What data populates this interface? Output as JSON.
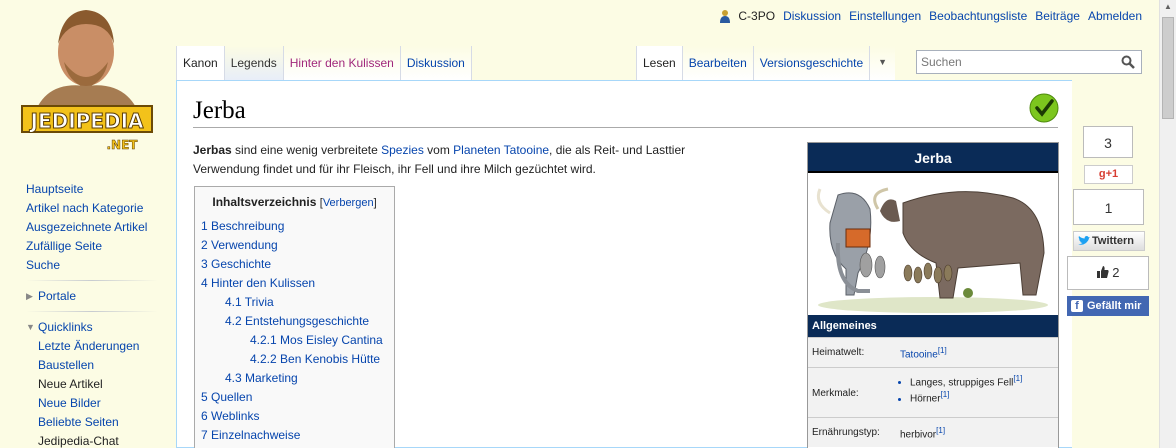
{
  "personal": {
    "username": "C-3PO",
    "links": [
      "Diskussion",
      "Einstellungen",
      "Beobachtungsliste",
      "Beiträge",
      "Abmelden"
    ]
  },
  "tabs": {
    "left": [
      "Kanon",
      "Legends",
      "Hinter den Kulissen",
      "Diskussion"
    ],
    "right": [
      "Lesen",
      "Bearbeiten",
      "Versionsgeschichte"
    ]
  },
  "search": {
    "placeholder": "Suchen"
  },
  "logo": {
    "text": "JEDIPEDIA",
    "subtext": ".NET"
  },
  "nav": {
    "main": [
      "Hauptseite",
      "Artikel nach Kategorie",
      "Ausgezeichnete Artikel",
      "Zufällige Seite",
      "Suche"
    ],
    "portale": "Portale",
    "quicklinks": "Quicklinks",
    "quick_items": [
      "Letzte Änderungen",
      "Baustellen",
      "Neue Artikel",
      "Neue Bilder",
      "Beliebte Seiten",
      "Jedipedia-Chat"
    ]
  },
  "article": {
    "title": "Jerba",
    "intro_bold": "Jerbas",
    "intro_1": " sind eine wenig verbreitete ",
    "intro_link1": "Spezies",
    "intro_2": " vom ",
    "intro_link2": "Planeten",
    "intro_3": " ",
    "intro_link3": "Tatooine",
    "intro_4": ", die als Reit- und Lasttier Verwendung findet und für ihr Fleisch, ihr Fell und ihre Milch gezüchtet wird."
  },
  "toc": {
    "title": "Inhaltsverzeichnis",
    "toggle": "Verbergen",
    "items": [
      {
        "label": "1 Beschreibung",
        "level": 1
      },
      {
        "label": "2 Verwendung",
        "level": 1
      },
      {
        "label": "3 Geschichte",
        "level": 1
      },
      {
        "label": "4 Hinter den Kulissen",
        "level": 1
      },
      {
        "label": "4.1 Trivia",
        "level": 2
      },
      {
        "label": "4.2 Entstehungsgeschichte",
        "level": 2
      },
      {
        "label": "4.2.1 Mos Eisley Cantina",
        "level": 3
      },
      {
        "label": "4.2.2 Ben Kenobis Hütte",
        "level": 3
      },
      {
        "label": "4.3 Marketing",
        "level": 2
      },
      {
        "label": "5 Quellen",
        "level": 1
      },
      {
        "label": "6 Weblinks",
        "level": 1
      },
      {
        "label": "7 Einzelnachweise",
        "level": 1
      }
    ]
  },
  "infobox": {
    "title": "Jerba",
    "section": "Allgemeines",
    "heimatwelt_label": "Heimatwelt:",
    "heimatwelt_value": "Tatooine",
    "ref": "[1]",
    "merkmale_label": "Merkmale:",
    "merkmale_1": "Langes, struppiges Fell",
    "merkmale_2": "Hörner",
    "ernaehrung_label": "Ernährungstyp:",
    "ernaehrung_value": "herbivor"
  },
  "social": {
    "gplus_count": "3",
    "gplus_label": "+1",
    "twitter_count": "1",
    "twitter_label": "Twittern",
    "fb_count": "2",
    "fb_label": "Gefällt mir"
  }
}
